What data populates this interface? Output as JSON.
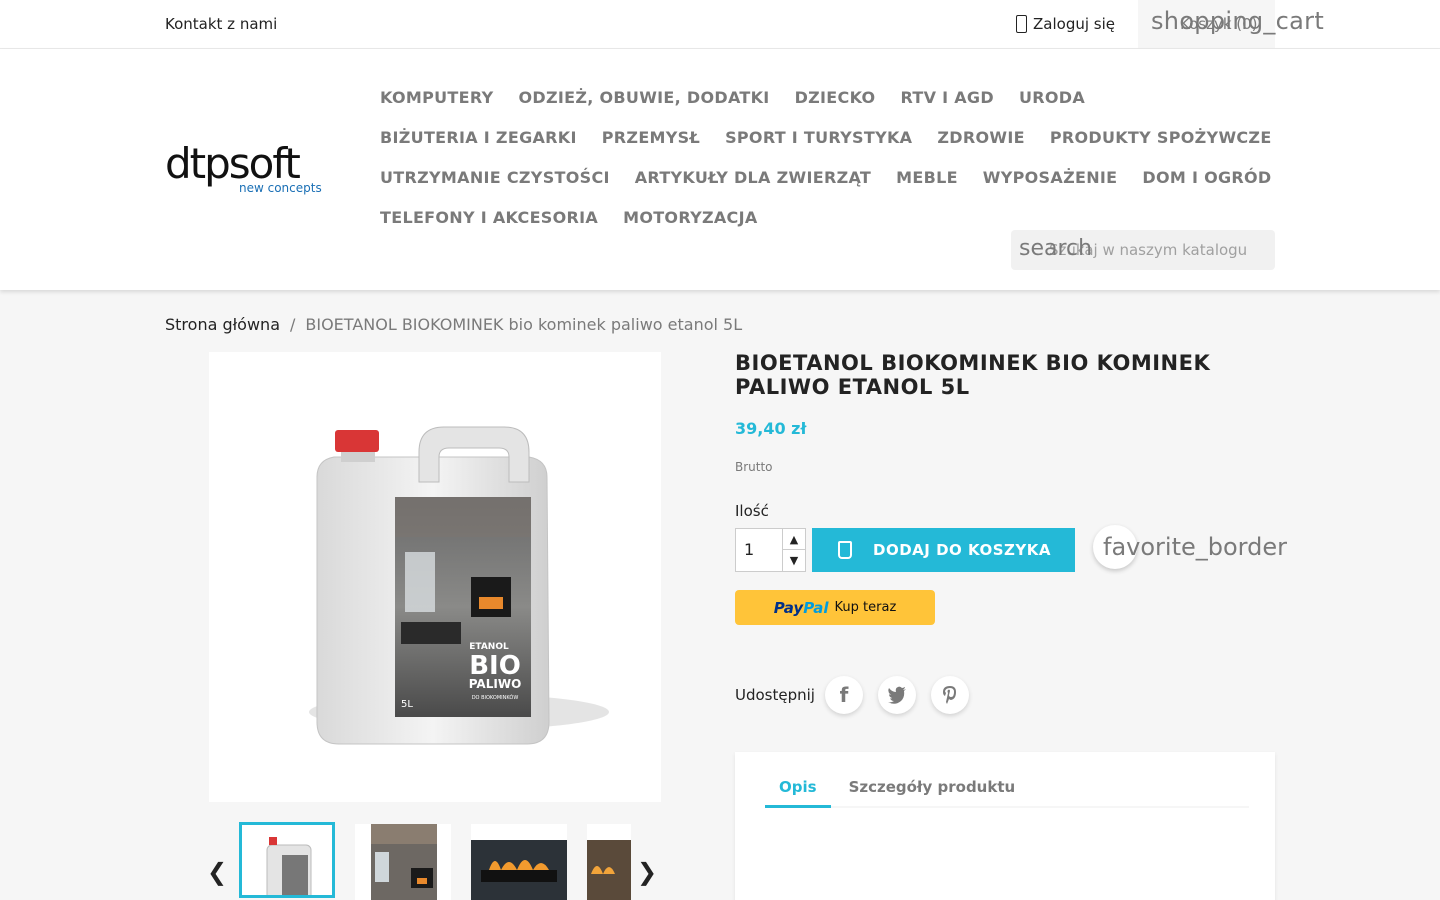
{
  "topbar": {
    "contact": "Kontakt z nami",
    "login": "Zaloguj się",
    "cart_icon": "shopping_cart",
    "cart_label": "Koszyk (0)"
  },
  "logo": {
    "main": "dtpsoft",
    "sub": "new concepts"
  },
  "nav": {
    "rows": [
      [
        "KOMPUTERY",
        "ODZIEŻ, OBUWIE, DODATKI",
        "DZIECKO",
        "RTV I AGD",
        "URODA"
      ],
      [
        "BIŻUTERIA I ZEGARKI",
        "PRZEMYSŁ",
        "SPORT I TURYSTYKA",
        "ZDROWIE",
        "PRODUKTY SPOŻYWCZE"
      ],
      [
        "UTRZYMANIE CZYSTOŚCI",
        "ARTYKUŁY DLA ZWIERZĄT",
        "MEBLE",
        "WYPOSAŻENIE",
        "DOM I OGRÓD"
      ],
      [
        "TELEFONY I AKCESORIA",
        "MOTORYZACJA"
      ]
    ]
  },
  "search": {
    "icon": "search",
    "placeholder": "Szukaj w naszym katalogu"
  },
  "breadcrumb": {
    "home": "Strona główna",
    "separator": "/",
    "current": "BIOETANOL BIOKOMINEK bio kominek paliwo etanol 5L"
  },
  "product": {
    "title": "BIOETANOL BIOKOMINEK BIO KOMINEK PALIWO ETANOL 5L",
    "price": "39,40 zł",
    "tax_label": "Brutto",
    "qty_label": "Ilość",
    "qty_value": "1",
    "add_to_cart": "DODAJ DO KOSZYKA",
    "wishlist_icon": "favorite_border",
    "paypal_logo_1": "Pay",
    "paypal_logo_2": "Pal",
    "paypal_text": "Kup teraz",
    "share_label": "Udostępnij",
    "canister": {
      "brand_line": "ETANOL",
      "bio": "BIO",
      "paliwo": "PALIWO",
      "sub": "DO BIOKOMINKÓW",
      "volume": "5L"
    }
  },
  "tabs": {
    "items": [
      "Opis",
      "Szczegóły produktu"
    ],
    "active": "Opis"
  },
  "colors": {
    "accent": "#24b9d7",
    "paypal": "#ffc439",
    "nav_text": "#7a7a7a"
  }
}
